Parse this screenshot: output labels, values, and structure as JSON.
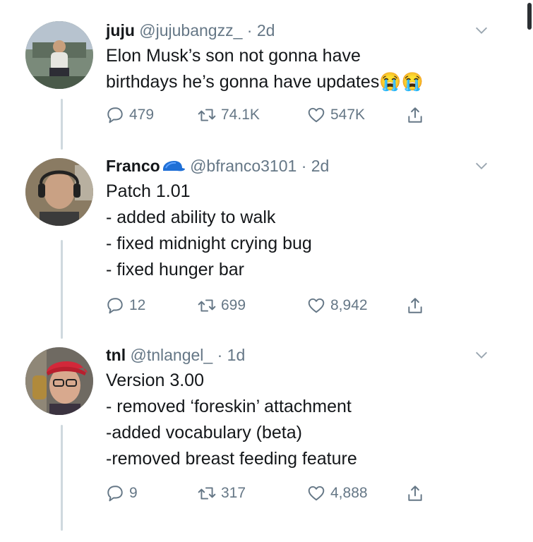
{
  "tweets": [
    {
      "name": "juju",
      "handle": "@jujubangzz_",
      "separator": "·",
      "time": "2d",
      "lines": [
        "Elon Musk’s son not gonna have",
        "birthdays he’s gonna have updates😭😭"
      ],
      "replies": "479",
      "retweets": "74.1K",
      "likes": "547K"
    },
    {
      "name": "Franco",
      "handle": "@bfranco3101",
      "separator": "·",
      "time": "2d",
      "lines": [
        "Patch 1.01",
        "- added ability to walk",
        "- fixed midnight crying bug",
        "- fixed hunger bar"
      ],
      "replies": "12",
      "retweets": "699",
      "likes": "8,942"
    },
    {
      "name": "tnl",
      "handle": "@tnlangel_",
      "separator": "·",
      "time": "1d",
      "lines": [
        "Version 3.00",
        "- removed ‘foreskin’ attachment",
        "-added vocabulary (beta)",
        "-removed breast feeding feature"
      ],
      "replies": "9",
      "retweets": "317",
      "likes": "4,888"
    }
  ],
  "icons": {
    "reply": "reply-icon",
    "retweet": "retweet-icon",
    "like": "heart-icon",
    "share": "share-icon",
    "more": "chevron-down-icon",
    "verified": "blue-cap-emoji"
  },
  "colors": {
    "secondary_text": "#657786",
    "thread_line": "#cfd9de",
    "cap_blue": "#1f6fd6"
  }
}
